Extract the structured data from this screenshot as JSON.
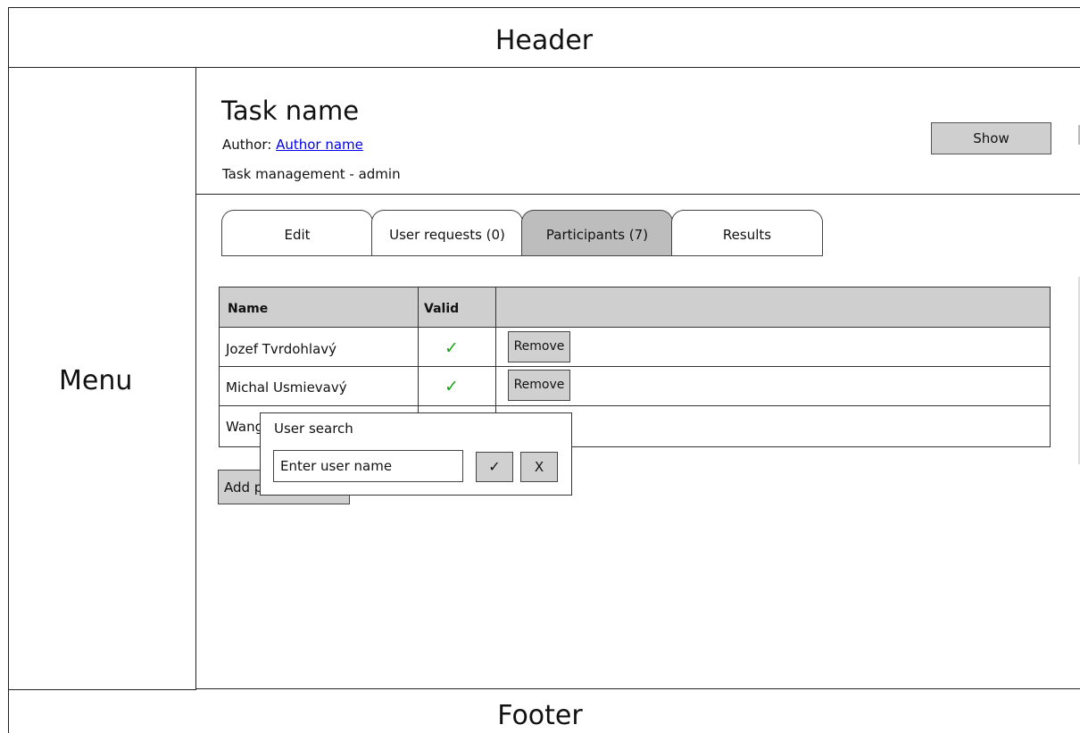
{
  "header": {
    "title": "Header"
  },
  "menu": {
    "label": "Menu"
  },
  "footer": {
    "label": "Footer"
  },
  "task": {
    "title": "Task name",
    "author_prefix": "Author:",
    "author_name": "Author name",
    "subtitle": "Task management - admin",
    "show_label": "Show"
  },
  "tabs": [
    {
      "label": "Edit",
      "active": false
    },
    {
      "label": "User requests (0)",
      "active": false
    },
    {
      "label": "Participants (7)",
      "active": true
    },
    {
      "label": "Results",
      "active": false
    }
  ],
  "table": {
    "columns": [
      "Name",
      "Valid",
      ""
    ],
    "rows": [
      {
        "name": "Jozef Tvrdohlavý",
        "valid": "✓",
        "action": "Remove"
      },
      {
        "name": "Michal Usmievavý",
        "valid": "✓",
        "action": "Remove"
      },
      {
        "name": "Wang",
        "valid": "",
        "action": ""
      }
    ]
  },
  "add_button": {
    "label": "Add participant"
  },
  "popup": {
    "title": "User search",
    "input_placeholder": "Enter user name",
    "confirm_label": "✓",
    "cancel_label": "X"
  },
  "colors": {
    "check_green": "#1aa31a",
    "link_blue": "#0000ee",
    "button_gray": "#cfcfcf",
    "active_tab_gray": "#bdbdbd"
  }
}
